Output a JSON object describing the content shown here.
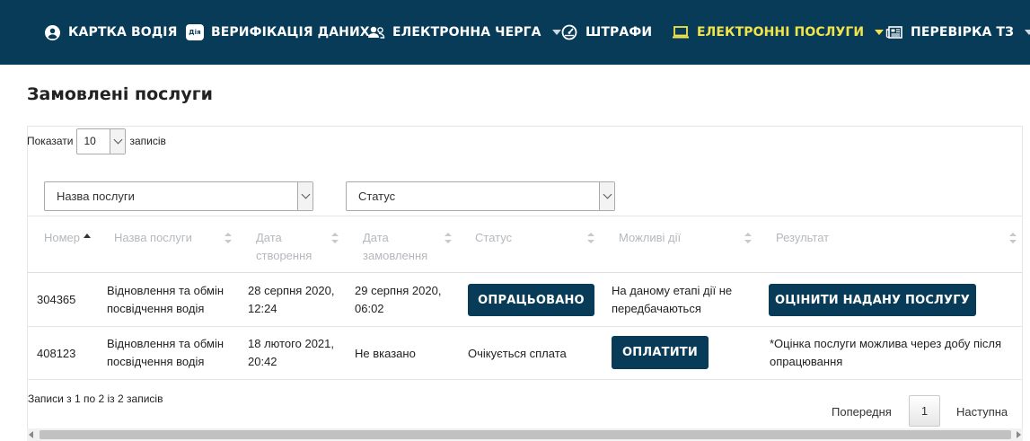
{
  "nav": {
    "items": [
      {
        "label": "КАРТКА ВОДІЯ",
        "icon": "user-circle-icon"
      },
      {
        "label": "ВЕРИФІКАЦІЯ ДАНИХ",
        "icon": "diia-icon",
        "badge": "Дія"
      },
      {
        "label": "ЕЛЕКТРОННА ЧЕРГА",
        "icon": "users-icon"
      },
      {
        "label": "ШТРАФИ",
        "icon": "speedometer-icon"
      },
      {
        "label": "ЕЛЕКТРОННІ ПОСЛУГИ",
        "icon": "laptop-icon",
        "active": true
      },
      {
        "label": "ПЕРЕВІРКА ТЗ",
        "icon": "newspaper-icon"
      }
    ],
    "bg_color": "#073b57",
    "active_color": "#f2e34a"
  },
  "page": {
    "title": "Замовлені послуги"
  },
  "length": {
    "prefix": "Показати",
    "value": "10",
    "suffix": "записів"
  },
  "filters": {
    "service": "Назва послуги",
    "status": "Статус"
  },
  "table": {
    "headers": {
      "number": "Номер",
      "service": "Назва послуги",
      "created_1": "Дата",
      "created_2": "створення",
      "ordered_1": "Дата",
      "ordered_2": "замовлення",
      "status": "Статус",
      "actions": "Можливі дії",
      "result": "Результат"
    },
    "rows": [
      {
        "number": "304365",
        "service_1": "Відновлення та обмін",
        "service_2": "посвідчення водія",
        "created_1": "28 серпня 2020,",
        "created_2": "12:24",
        "ordered_1": "29 серпня 2020,",
        "ordered_2": "06:02",
        "status_button": "ОПРАЦЬОВАНО",
        "actions_1": "На даному етапі дії не",
        "actions_2": "передбачаються",
        "result_button": "ОЦІНИТИ НАДАНУ ПОСЛУГУ"
      },
      {
        "number": "408123",
        "service_1": "Відновлення та обмін",
        "service_2": "посвідчення водія",
        "created_1": "18 лютого 2021,",
        "created_2": "20:42",
        "ordered": "Не вказано",
        "status": "Очікується сплата",
        "action_button": "ОПЛАТИТИ",
        "result_1": "*Оцінка послуги можлива через добу після",
        "result_2": "опрацювання"
      }
    ]
  },
  "footer": {
    "info": "Записи з 1 по 2 із 2 записів",
    "prev": "Попередня",
    "page": "1",
    "next": "Наступна"
  }
}
